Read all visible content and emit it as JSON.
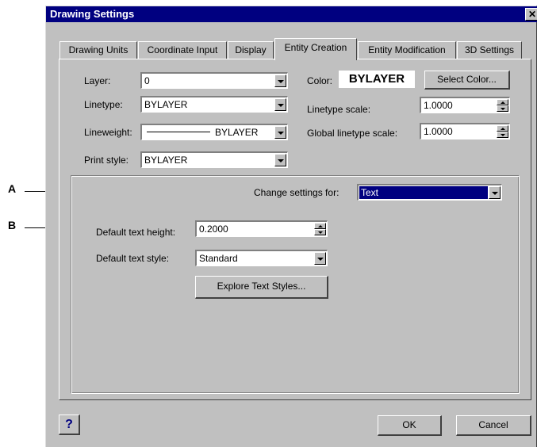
{
  "window": {
    "title": "Drawing Settings",
    "close_glyph": "✕"
  },
  "tabs": [
    {
      "label": "Drawing Units"
    },
    {
      "label": "Coordinate Input"
    },
    {
      "label": "Display"
    },
    {
      "label": "Entity Creation"
    },
    {
      "label": "Entity Modification"
    },
    {
      "label": "3D Settings"
    }
  ],
  "active_tab": "Entity Creation",
  "entity": {
    "layer_label": "Layer:",
    "layer_value": "0",
    "linetype_label": "Linetype:",
    "linetype_value": "BYLAYER",
    "lineweight_label": "Lineweight:",
    "lineweight_value": "BYLAYER",
    "print_style_label": "Print style:",
    "print_style_value": "BYLAYER",
    "color_label": "Color:",
    "color_value": "BYLAYER",
    "select_color_label": "Select Color...",
    "linetype_scale_label": "Linetype scale:",
    "linetype_scale_value": "1.0000",
    "global_linetype_scale_label": "Global linetype scale:",
    "global_linetype_scale_value": "1.0000"
  },
  "group": {
    "change_settings_label": "Change settings for:",
    "change_settings_value": "Text",
    "default_text_height_label": "Default text height:",
    "default_text_height_value": "0.2000",
    "default_text_style_label": "Default text style:",
    "default_text_style_value": "Standard",
    "explore_text_styles_label": "Explore Text Styles..."
  },
  "footer": {
    "help_label": "?",
    "ok_label": "OK",
    "cancel_label": "Cancel"
  },
  "callouts": [
    {
      "letter": "A"
    },
    {
      "letter": "B"
    }
  ],
  "colors": {
    "titlebar": "#000080",
    "dialog_face": "#c0c0c0",
    "selection": "#000080",
    "help_glyph": "#000080"
  }
}
